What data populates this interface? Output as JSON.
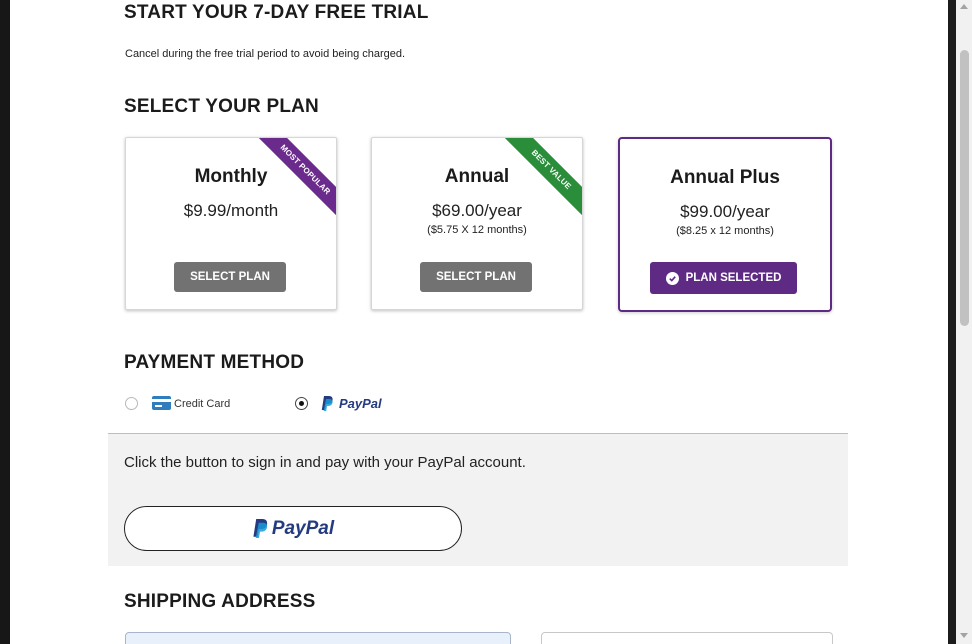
{
  "header": {
    "title": "START YOUR 7-DAY FREE TRIAL",
    "subtitle": "Cancel during the free trial period to avoid being charged."
  },
  "plan_section": {
    "title": "SELECT YOUR PLAN",
    "plans": [
      {
        "name": "Monthly",
        "price": "$9.99/month",
        "sub": "",
        "ribbon": "MOST POPULAR",
        "ribbon_color": "#6a2b8c",
        "button": "SELECT PLAN",
        "selected": false
      },
      {
        "name": "Annual",
        "price": "$69.00/year",
        "sub": "($5.75 X 12 months)",
        "ribbon": "BEST VALUE",
        "ribbon_color": "#2a8d3a",
        "button": "SELECT PLAN",
        "selected": false
      },
      {
        "name": "Annual Plus",
        "price": "$99.00/year",
        "sub": "($8.25 x 12 months)",
        "ribbon": "",
        "button": "PLAN SELECTED",
        "selected": true
      }
    ],
    "selected_color": "#5e2a84"
  },
  "payment": {
    "title": "PAYMENT METHOD",
    "options": [
      {
        "label": "Credit Card",
        "icon": "credit-card-icon",
        "checked": false
      },
      {
        "label": "PayPal",
        "icon": "paypal-logo",
        "checked": true
      }
    ],
    "panel_text": "Click the button to sign in and pay with your PayPal account.",
    "paypal_button_label": "PayPal"
  },
  "shipping": {
    "title": "SHIPPING ADDRESS"
  }
}
